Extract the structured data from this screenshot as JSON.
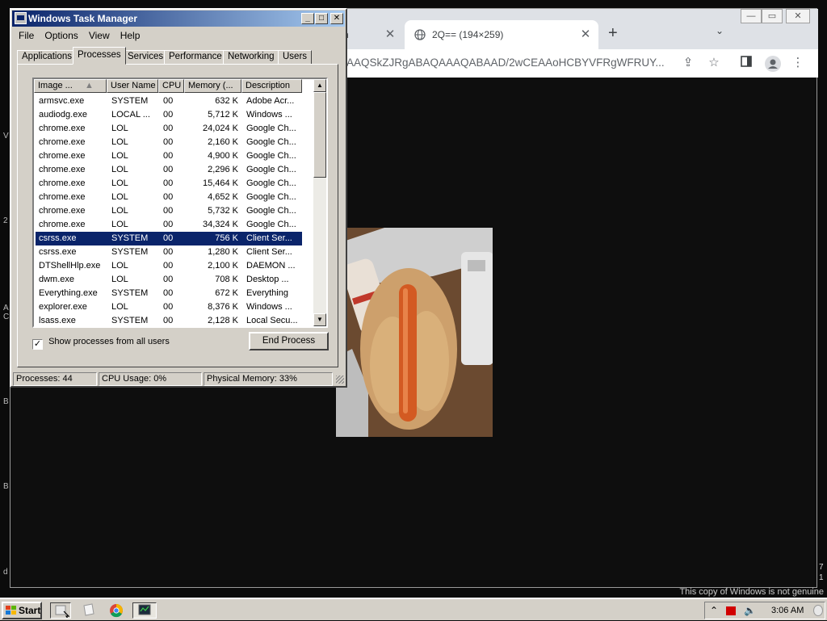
{
  "desktop": {
    "edge_letters": [
      "V",
      "2",
      "A",
      "C",
      "B",
      "B",
      "d"
    ],
    "watermark": "This copy of Windows is not genuine",
    "side_digits": [
      "7",
      "1"
    ]
  },
  "browser": {
    "tab1_partial_title": "h",
    "tab2_title": "2Q== (194×259)",
    "url": "AAQSkZJRgABAQAAAQABAAD/2wCEAAoHCBYVFRgWFRUY..."
  },
  "taskmgr": {
    "title": "Windows Task Manager",
    "menus": [
      "File",
      "Options",
      "View",
      "Help"
    ],
    "tabs": [
      "Applications",
      "Processes",
      "Services",
      "Performance",
      "Networking",
      "Users"
    ],
    "active_tab": "Processes",
    "columns": [
      "Image ...",
      "User Name",
      "CPU",
      "Memory (...",
      "Description"
    ],
    "processes": [
      {
        "image": "armsvc.exe",
        "user": "SYSTEM",
        "cpu": "00",
        "mem": "632 K",
        "desc": "Adobe Acr..."
      },
      {
        "image": "audiodg.exe",
        "user": "LOCAL ...",
        "cpu": "00",
        "mem": "5,712 K",
        "desc": "Windows ..."
      },
      {
        "image": "chrome.exe",
        "user": "LOL",
        "cpu": "00",
        "mem": "24,024 K",
        "desc": "Google Ch..."
      },
      {
        "image": "chrome.exe",
        "user": "LOL",
        "cpu": "00",
        "mem": "2,160 K",
        "desc": "Google Ch..."
      },
      {
        "image": "chrome.exe",
        "user": "LOL",
        "cpu": "00",
        "mem": "4,900 K",
        "desc": "Google Ch..."
      },
      {
        "image": "chrome.exe",
        "user": "LOL",
        "cpu": "00",
        "mem": "2,296 K",
        "desc": "Google Ch..."
      },
      {
        "image": "chrome.exe",
        "user": "LOL",
        "cpu": "00",
        "mem": "15,464 K",
        "desc": "Google Ch..."
      },
      {
        "image": "chrome.exe",
        "user": "LOL",
        "cpu": "00",
        "mem": "4,652 K",
        "desc": "Google Ch..."
      },
      {
        "image": "chrome.exe",
        "user": "LOL",
        "cpu": "00",
        "mem": "5,732 K",
        "desc": "Google Ch..."
      },
      {
        "image": "chrome.exe",
        "user": "LOL",
        "cpu": "00",
        "mem": "34,324 K",
        "desc": "Google Ch..."
      },
      {
        "image": "csrss.exe",
        "user": "SYSTEM",
        "cpu": "00",
        "mem": "756 K",
        "desc": "Client Ser...",
        "selected": true
      },
      {
        "image": "csrss.exe",
        "user": "SYSTEM",
        "cpu": "00",
        "mem": "1,280 K",
        "desc": "Client Ser..."
      },
      {
        "image": "DTShellHlp.exe",
        "user": "LOL",
        "cpu": "00",
        "mem": "2,100 K",
        "desc": "DAEMON ..."
      },
      {
        "image": "dwm.exe",
        "user": "LOL",
        "cpu": "00",
        "mem": "708 K",
        "desc": "Desktop ..."
      },
      {
        "image": "Everything.exe",
        "user": "SYSTEM",
        "cpu": "00",
        "mem": "672 K",
        "desc": "Everything"
      },
      {
        "image": "explorer.exe",
        "user": "LOL",
        "cpu": "00",
        "mem": "8,376 K",
        "desc": "Windows ..."
      },
      {
        "image": "lsass.exe",
        "user": "SYSTEM",
        "cpu": "00",
        "mem": "2,128 K",
        "desc": "Local Secu..."
      }
    ],
    "show_all_label": "Show processes from all users",
    "show_all_checked": true,
    "end_process_label": "End Process",
    "status": {
      "processes": "Processes: 44",
      "cpu": "CPU Usage: 0%",
      "memory": "Physical Memory: 33%"
    }
  },
  "taskbar": {
    "start_label": "Start",
    "clock": "3:06 AM"
  },
  "colors": {
    "selection": "#0a246a",
    "title_gradient_start": "#0a246a",
    "title_gradient_end": "#a6caf0",
    "face": "#d4d0c8"
  }
}
